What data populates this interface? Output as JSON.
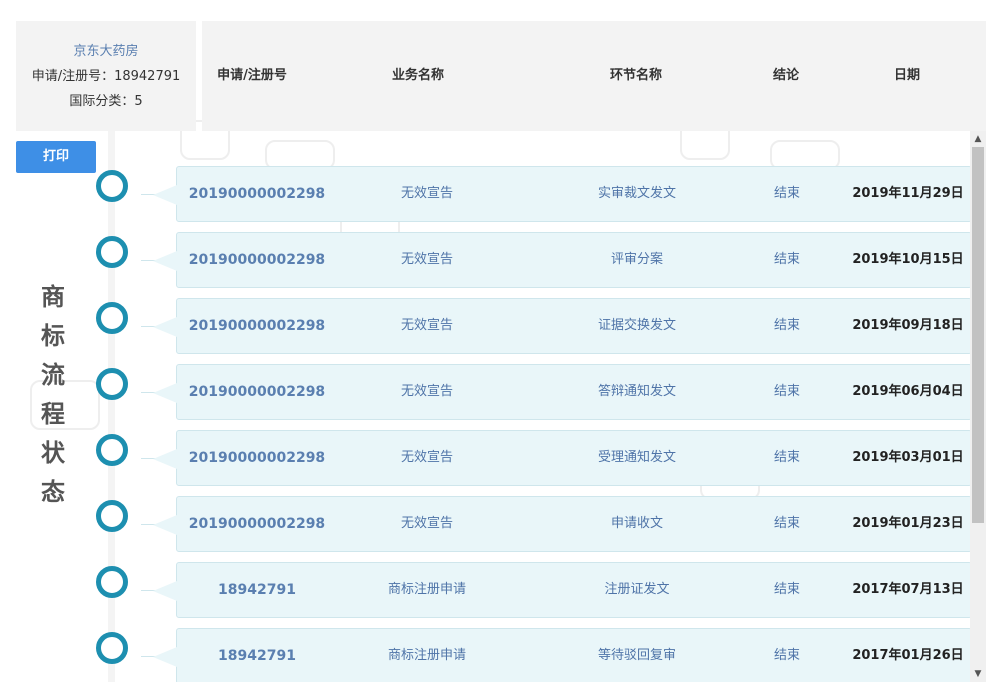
{
  "header": {
    "company": "京东大药房",
    "reg_line": "申请/注册号：18942791",
    "class_line": "国际分类：5",
    "columns": [
      "申请/注册号",
      "业务名称",
      "环节名称",
      "结论",
      "日期"
    ]
  },
  "print_label": "打印",
  "vertical_title": [
    "商",
    "标",
    "流",
    "程",
    "状",
    "态"
  ],
  "rows": [
    {
      "reg": "20190000002298",
      "business": "无效宣告",
      "step": "实审裁文发文",
      "result": "结束",
      "date": "2019年11月29日"
    },
    {
      "reg": "20190000002298",
      "business": "无效宣告",
      "step": "评审分案",
      "result": "结束",
      "date": "2019年10月15日"
    },
    {
      "reg": "20190000002298",
      "business": "无效宣告",
      "step": "证据交换发文",
      "result": "结束",
      "date": "2019年09月18日"
    },
    {
      "reg": "20190000002298",
      "business": "无效宣告",
      "step": "答辩通知发文",
      "result": "结束",
      "date": "2019年06月04日"
    },
    {
      "reg": "20190000002298",
      "business": "无效宣告",
      "step": "受理通知发文",
      "result": "结束",
      "date": "2019年03月01日"
    },
    {
      "reg": "20190000002298",
      "business": "无效宣告",
      "step": "申请收文",
      "result": "结束",
      "date": "2019年01月23日"
    },
    {
      "reg": "18942791",
      "business": "商标注册申请",
      "step": "注册证发文",
      "result": "结束",
      "date": "2017年07月13日"
    },
    {
      "reg": "18942791",
      "business": "商标注册申请",
      "step": "等待驳回复审",
      "result": "结束",
      "date": "2017年01月26日"
    }
  ],
  "scrollbar": {
    "up_icon": "▲",
    "down_icon": "▼"
  }
}
